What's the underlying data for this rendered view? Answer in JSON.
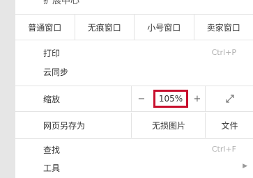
{
  "top_clipped": "扩展中心",
  "window_buttons": [
    "普通窗口",
    "无痕窗口",
    "小号窗口",
    "卖家窗口"
  ],
  "print": {
    "label": "打印",
    "shortcut": "Ctrl+P"
  },
  "cloud_sync": {
    "label": "云同步"
  },
  "zoom": {
    "label": "缩放",
    "minus": "−",
    "value": "105%",
    "plus": "+"
  },
  "save_as": {
    "label": "网页另存为",
    "image": "无损图片",
    "file": "文件"
  },
  "find": {
    "label": "查找",
    "shortcut": "Ctrl+F"
  },
  "tools": {
    "label": "工具",
    "arrow": "▶"
  },
  "colors": {
    "highlight": "#c8102e",
    "divider": "#e3e3e3",
    "muted": "#b0b0b0"
  }
}
